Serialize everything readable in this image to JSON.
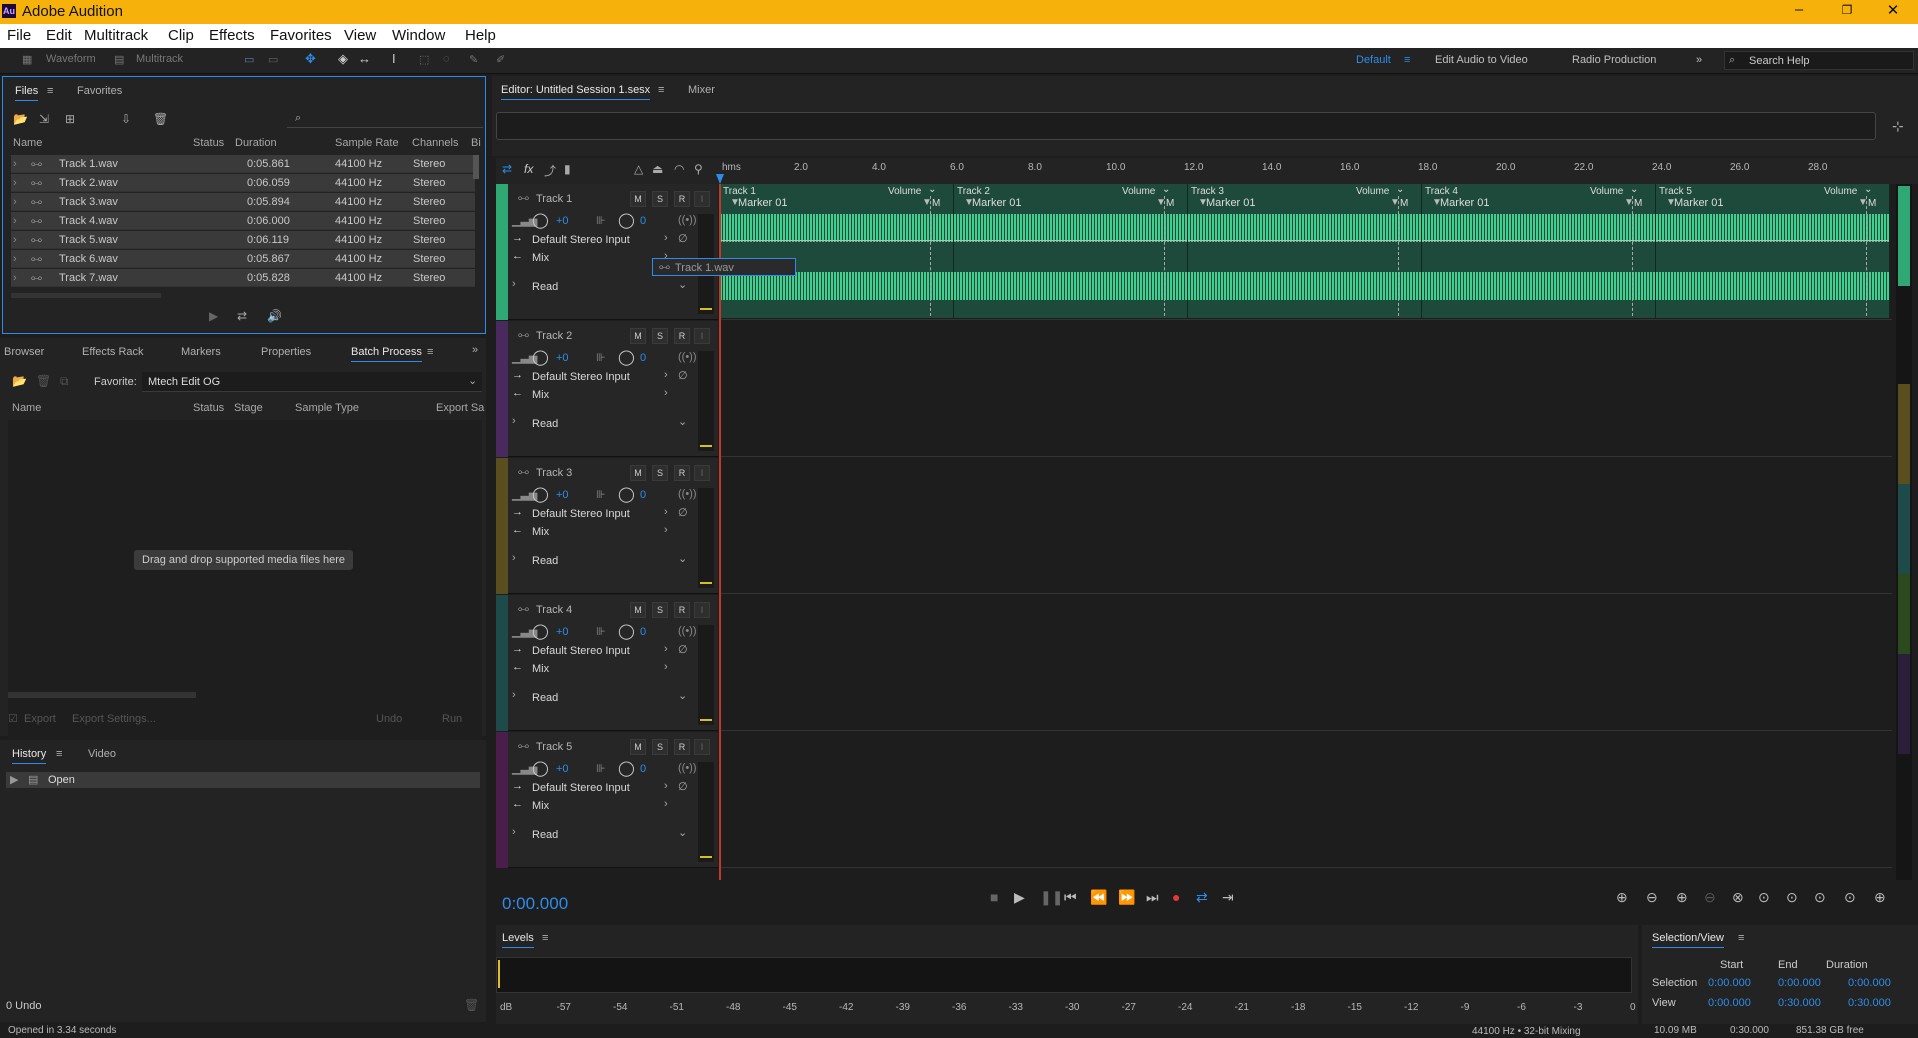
{
  "app": {
    "title": "Adobe Audition",
    "logo": "Au"
  },
  "menu": [
    "File",
    "Edit",
    "Multitrack",
    "Clip",
    "Effects",
    "Favorites",
    "View",
    "Window",
    "Help"
  ],
  "toolbar": {
    "waveform": "Waveform",
    "multitrack": "Multitrack",
    "workspaces": [
      "Default",
      "Edit Audio to Video",
      "Radio Production"
    ],
    "search_placeholder": "Search Help"
  },
  "files_panel": {
    "tabs": [
      "Files",
      "Favorites"
    ],
    "columns": [
      "Name",
      "Status",
      "Duration",
      "Sample Rate",
      "Channels",
      "Bi"
    ],
    "rows": [
      {
        "name": "Track 1.wav",
        "duration": "0:05.861",
        "rate": "44100 Hz",
        "channels": "Stereo"
      },
      {
        "name": "Track 2.wav",
        "duration": "0:06.059",
        "rate": "44100 Hz",
        "channels": "Stereo"
      },
      {
        "name": "Track 3.wav",
        "duration": "0:05.894",
        "rate": "44100 Hz",
        "channels": "Stereo"
      },
      {
        "name": "Track 4.wav",
        "duration": "0:06.000",
        "rate": "44100 Hz",
        "channels": "Stereo"
      },
      {
        "name": "Track 5.wav",
        "duration": "0:06.119",
        "rate": "44100 Hz",
        "channels": "Stereo"
      },
      {
        "name": "Track 6.wav",
        "duration": "0:05.867",
        "rate": "44100 Hz",
        "channels": "Stereo"
      },
      {
        "name": "Track 7.wav",
        "duration": "0:05.828",
        "rate": "44100 Hz",
        "channels": "Stereo"
      }
    ]
  },
  "batch_panel": {
    "tabs": [
      "Browser",
      "Effects Rack",
      "Markers",
      "Properties",
      "Batch Process"
    ],
    "favorite_label": "Favorite:",
    "favorite_value": "Mtech Edit OG",
    "columns": [
      "Name",
      "Status",
      "Stage",
      "Sample Type",
      "Export Sa"
    ],
    "drop_hint": "Drag and drop supported media files here",
    "export": "Export",
    "export_settings": "Export Settings...",
    "undo": "Undo",
    "run": "Run"
  },
  "history_panel": {
    "tabs": [
      "History",
      "Video"
    ],
    "item": "Open",
    "undo_count": "0 Undo"
  },
  "editor": {
    "tab": "Editor: Untitled Session 1.sesx",
    "mixer": "Mixer",
    "ruler_unit": "hms",
    "ruler": [
      "2.0",
      "4.0",
      "6.0",
      "8.0",
      "10.0",
      "12.0",
      "14.0",
      "16.0",
      "18.0",
      "20.0",
      "22.0",
      "24.0",
      "26.0",
      "28.0"
    ],
    "drag_label": "Track 1.wav"
  },
  "tracks": [
    {
      "name": "Track 1",
      "color": "#2fa874",
      "vol": "+0",
      "pan": "0",
      "input": "Default Stereo Input",
      "output": "Mix",
      "mode": "Read"
    },
    {
      "name": "Track 2",
      "color": "#4a2a5e",
      "vol": "+0",
      "pan": "0",
      "input": "Default Stereo Input",
      "output": "Mix",
      "mode": "Read"
    },
    {
      "name": "Track 3",
      "color": "#5a4d1e",
      "vol": "+0",
      "pan": "0",
      "input": "Default Stereo Input",
      "output": "Mix",
      "mode": "Read"
    },
    {
      "name": "Track 4",
      "color": "#1e4a4a",
      "vol": "+0",
      "pan": "0",
      "input": "Default Stereo Input",
      "output": "Mix",
      "mode": "Read"
    },
    {
      "name": "Track 5",
      "color": "#4a1e4a",
      "vol": "+0",
      "pan": "0",
      "input": "Default Stereo Input",
      "output": "Mix",
      "mode": "Read"
    }
  ],
  "clips": [
    {
      "name": "Track 1",
      "marker": "Marker 01"
    },
    {
      "name": "Track 2",
      "marker": "Marker 01"
    },
    {
      "name": "Track 3",
      "marker": "Marker 01"
    },
    {
      "name": "Track 4",
      "marker": "Marker 01"
    },
    {
      "name": "Track 5",
      "marker": "Marker 01"
    }
  ],
  "clip_volume": "Volume",
  "clip_m": "M",
  "track_buttons": {
    "m": "M",
    "s": "S",
    "r": "R"
  },
  "transport": {
    "time": "0:00.000"
  },
  "levels": {
    "title": "Levels",
    "scale": [
      "dB",
      "-57",
      "-54",
      "-51",
      "-48",
      "-45",
      "-42",
      "-39",
      "-36",
      "-33",
      "-30",
      "-27",
      "-24",
      "-21",
      "-18",
      "-15",
      "-12",
      "-9",
      "-6",
      "-3",
      "0"
    ]
  },
  "selection_view": {
    "title": "Selection/View",
    "start": "Start",
    "end": "End",
    "duration": "Duration",
    "selection": "Selection",
    "view": "View",
    "sel_start": "0:00.000",
    "sel_end": "0:00.000",
    "sel_dur": "0:00.000",
    "view_start": "0:00.000",
    "view_end": "0:30.000",
    "view_dur": "0:30.000"
  },
  "status": {
    "left": "Opened in 3.34 seconds",
    "rate": "44100 Hz • 32-bit Mixing",
    "mem": "10.09 MB",
    "dur": "0:30.000",
    "free": "851.38 GB free"
  }
}
